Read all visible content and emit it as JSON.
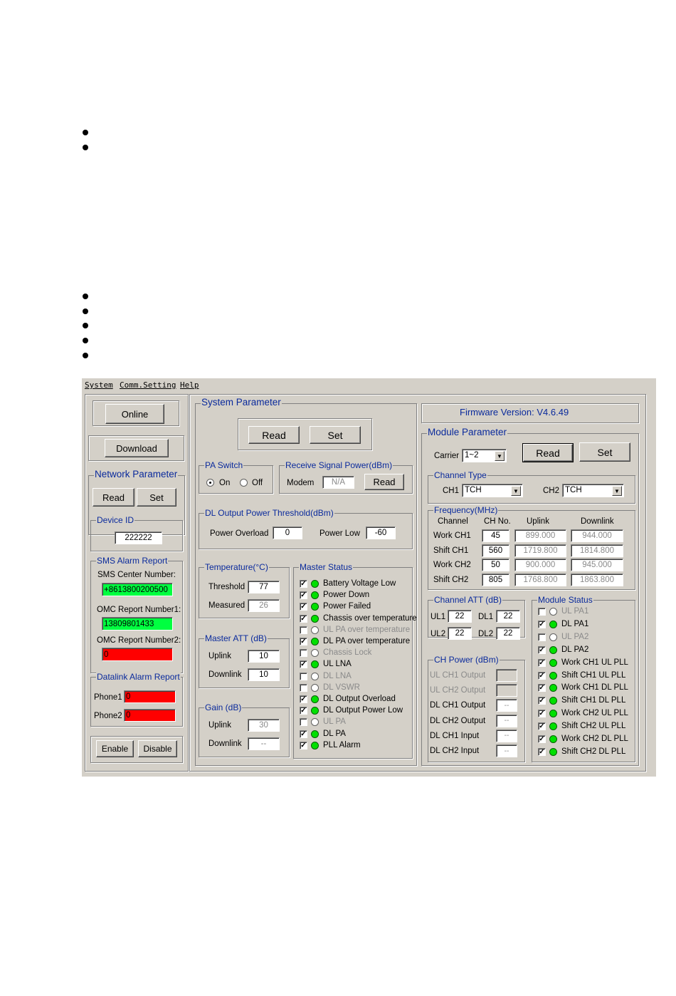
{
  "menu": {
    "system": "System",
    "comm_setting": "Comm.Setting",
    "help": "Help"
  },
  "left": {
    "online": "Online",
    "download": "Download",
    "network_param_title": "Network Parameter",
    "read": "Read",
    "set": "Set",
    "device_id_title": "Device ID",
    "device_id": "222222",
    "sms_title": "SMS Alarm Report",
    "sms_center_label": "SMS Center Number:",
    "sms_center": "+8613800200500",
    "omc1_label": "OMC Report Number1:",
    "omc1": "13809801433",
    "omc2_label": "OMC Report Number2:",
    "omc2": "0",
    "datalink_title": "Datalink Alarm Report",
    "phone1_label": "Phone1",
    "phone1": "0",
    "phone2_label": "Phone2",
    "phone2": "0",
    "enable": "Enable",
    "disable": "Disable"
  },
  "system": {
    "title": "System Parameter",
    "read": "Read",
    "set": "Set",
    "pa_switch_title": "PA Switch",
    "on": "On",
    "off": "Off",
    "rsp_title": "Receive Signal Power(dBm)",
    "modem_label": "Modem",
    "modem_value": "N/A",
    "rsp_read": "Read",
    "dl_threshold_title": "DL Output Power Threshold(dBm)",
    "overload_label": "Power Overload",
    "overload_value": "0",
    "low_label": "Power Low",
    "low_value": "-60",
    "temp_title": "Temperature(°C)",
    "threshold_label": "Threshold",
    "threshold_value": "77",
    "measured_label": "Measured",
    "measured_value": "26",
    "master_att_title": "Master ATT (dB)",
    "att_uplink_label": "Uplink",
    "att_uplink": "10",
    "att_downlink_label": "Downlink",
    "att_downlink": "10",
    "gain_title": "Gain (dB)",
    "gain_uplink_label": "Uplink",
    "gain_uplink": "30",
    "gain_downlink_label": "Downlink",
    "gain_downlink": "--",
    "master_status_title": "Master Status",
    "master_status": [
      {
        "label": "Battery Voltage Low",
        "checked": true
      },
      {
        "label": "Power Down",
        "checked": true
      },
      {
        "label": "Power Failed",
        "checked": true
      },
      {
        "label": "Chassis over temperature",
        "checked": true
      },
      {
        "label": "UL PA over temperature",
        "checked": false
      },
      {
        "label": "DL PA over temperature",
        "checked": true
      },
      {
        "label": "Chassis Lock",
        "checked": false
      },
      {
        "label": "UL LNA",
        "checked": true
      },
      {
        "label": "DL LNA",
        "checked": false
      },
      {
        "label": "DL VSWR",
        "checked": false
      },
      {
        "label": "DL Output Overload",
        "checked": true
      },
      {
        "label": "DL Output Power Low",
        "checked": true
      },
      {
        "label": "UL PA",
        "checked": false
      },
      {
        "label": "DL PA",
        "checked": true
      },
      {
        "label": "PLL Alarm",
        "checked": true
      }
    ]
  },
  "module": {
    "firmware": "Firmware Version: V4.6.49",
    "title": "Module Parameter",
    "carrier_label": "Carrier",
    "carrier_value": "1~2",
    "read": "Read",
    "set": "Set",
    "channel_type_title": "Channel Type",
    "ch1_label": "CH1",
    "ch1_value": "TCH",
    "ch2_label": "CH2",
    "ch2_value": "TCH",
    "freq_title": "Frequency(MHz)",
    "freq_headers": [
      "Channel",
      "CH No.",
      "Uplink",
      "Downlink"
    ],
    "freq_rows": [
      {
        "channel": "Work CH1",
        "ch_no": "45",
        "uplink": "899.000",
        "downlink": "944.000"
      },
      {
        "channel": "Shift CH1",
        "ch_no": "560",
        "uplink": "1719.800",
        "downlink": "1814.800"
      },
      {
        "channel": "Work CH2",
        "ch_no": "50",
        "uplink": "900.000",
        "downlink": "945.000"
      },
      {
        "channel": "Shift CH2",
        "ch_no": "805",
        "uplink": "1768.800",
        "downlink": "1863.800"
      }
    ],
    "ch_att_title": "Channel ATT (dB)",
    "ul1_label": "UL1",
    "ul1": "22",
    "dl1_label": "DL1",
    "dl1": "22",
    "ul2_label": "UL2",
    "ul2": "22",
    "dl2_label": "DL2",
    "dl2": "22",
    "ch_power_title": "CH Power (dBm)",
    "ch_power": [
      {
        "label": "UL CH1 Output",
        "value": "",
        "disabled": true
      },
      {
        "label": "UL CH2 Output",
        "value": "",
        "disabled": true
      },
      {
        "label": "DL CH1 Output",
        "value": "--",
        "disabled": false
      },
      {
        "label": "DL CH2 Output",
        "value": "--",
        "disabled": false
      },
      {
        "label": "DL CH1 Input",
        "value": "--",
        "disabled": false
      },
      {
        "label": "DL CH2 Input",
        "value": "--",
        "disabled": false
      }
    ],
    "module_status_title": "Module Status",
    "module_status": [
      {
        "label": "UL PA1",
        "checked": false
      },
      {
        "label": "DL PA1",
        "checked": true
      },
      {
        "label": "UL PA2",
        "checked": false
      },
      {
        "label": "DL PA2",
        "checked": true
      },
      {
        "label": "Work CH1 UL PLL",
        "checked": true
      },
      {
        "label": "Shift CH1 UL PLL",
        "checked": true
      },
      {
        "label": "Work CH1 DL PLL",
        "checked": true
      },
      {
        "label": "Shift CH1 DL PLL",
        "checked": true
      },
      {
        "label": "Work CH2 UL PLL",
        "checked": true
      },
      {
        "label": "Shift CH2 UL PLL",
        "checked": true
      },
      {
        "label": "Work CH2 DL PLL",
        "checked": true
      },
      {
        "label": "Shift CH2 DL PLL",
        "checked": true
      }
    ]
  }
}
